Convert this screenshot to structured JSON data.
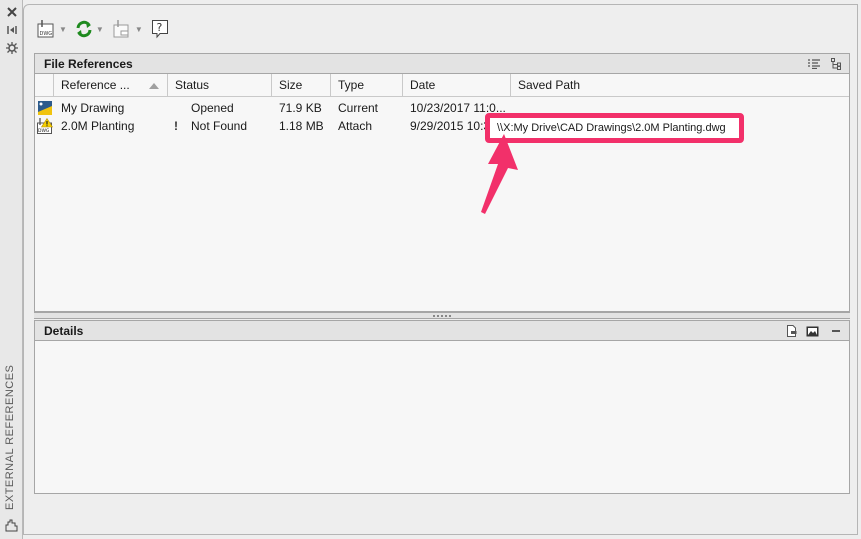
{
  "side_strip": {
    "title": "EXTERNAL REFERENCES",
    "buttons": [
      {
        "name": "close-icon",
        "glyph": "✕"
      },
      {
        "name": "auto-hide-icon",
        "glyph": "⧐"
      },
      {
        "name": "properties-icon",
        "glyph": "✲"
      }
    ]
  },
  "toolbar": {
    "attach_dwg_label": "DWG",
    "refresh": "refresh",
    "change_path": "change path",
    "help_glyph": "?"
  },
  "file_references": {
    "title": "File References",
    "columns": [
      "Reference ...",
      "Status",
      "Size",
      "Type",
      "Date",
      "Saved Path"
    ],
    "sort_column": "Reference ...",
    "sort_direction": "ascending",
    "rows": [
      {
        "icon": "current-drawing-icon",
        "name": "My Drawing",
        "warning": "",
        "status": "Opened",
        "size": "71.9 KB",
        "type": "Current",
        "date": "10/23/2017 11:0...",
        "saved_path": ""
      },
      {
        "icon": "dwg-not-found-icon",
        "name": "2.0M Planting",
        "warning": "!",
        "status": "Not Found",
        "size": "1.18 MB",
        "type": "Attach",
        "date": "9/29/2015 10:34:...",
        "saved_path": "\\\\X:My Drive\\CAD Drawings\\2.0M Planting.dwg"
      }
    ]
  },
  "details": {
    "title": "Details"
  },
  "annotation": {
    "highlight_color": "#f2306a",
    "callout_text": "\\\\X:My Drive\\CAD Drawings\\2.0M Planting.dwg"
  }
}
